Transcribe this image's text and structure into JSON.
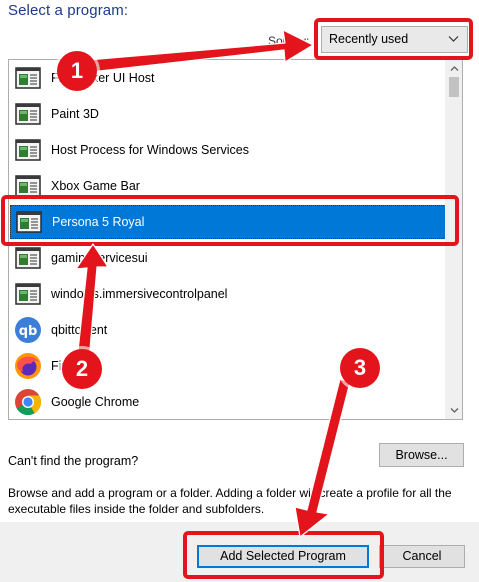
{
  "dialog": {
    "heading": "Select a program:",
    "sort_label": "Sort by:",
    "sort_value": "Recently used",
    "cant_find": "Can't find the program?",
    "browse_label": "Browse...",
    "description": "Browse and add a program or a folder. Adding a folder will create a profile for all the executable files inside the folder and subfolders.",
    "add_label": "Add Selected Program",
    "cancel_label": "Cancel"
  },
  "programs": [
    {
      "label": "File Picker UI Host",
      "icon": "app-window-icon"
    },
    {
      "label": "Paint 3D",
      "icon": "app-window-icon"
    },
    {
      "label": "Host Process for Windows Services",
      "icon": "app-window-icon"
    },
    {
      "label": "Xbox Game Bar",
      "icon": "app-window-icon"
    },
    {
      "label": "Persona 5 Royal",
      "icon": "app-window-icon",
      "selected": true
    },
    {
      "label": "gamingservicesui",
      "icon": "app-window-icon"
    },
    {
      "label": "windows.immersivecontrolpanel",
      "icon": "app-window-icon"
    },
    {
      "label": "qbittorrent",
      "icon": "qbittorrent-icon"
    },
    {
      "label": "Firefox",
      "icon": "firefox-icon"
    },
    {
      "label": "Google Chrome",
      "icon": "chrome-icon"
    }
  ],
  "annotations": {
    "callouts": [
      "1",
      "2",
      "3"
    ],
    "color": "#e3141b"
  },
  "colors": {
    "selection": "#0078d7",
    "heading": "#1e3a8a"
  }
}
